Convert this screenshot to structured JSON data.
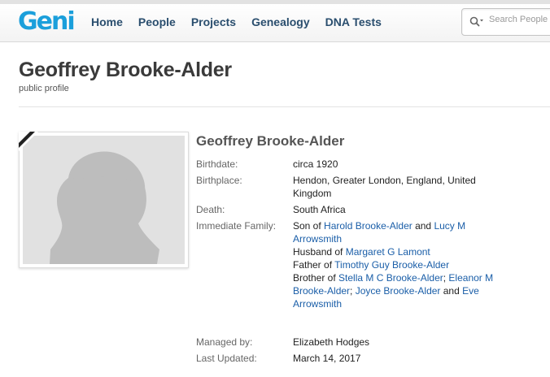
{
  "header": {
    "logo": "Geni",
    "nav": [
      "Home",
      "People",
      "Projects",
      "Genealogy",
      "DNA Tests"
    ],
    "search_placeholder": "Search People"
  },
  "profile": {
    "title": "Geoffrey Brooke-Alder",
    "subtitle": "public profile",
    "name": "Geoffrey Brooke-Alder",
    "birthdate_label": "Birthdate:",
    "birthdate": "circa 1920",
    "birthplace_label": "Birthplace:",
    "birthplace": "Hendon, Greater London, England, United Kingdom",
    "death_label": "Death:",
    "death": "South Africa",
    "family_label": "Immediate Family:",
    "family": {
      "son_of": "Son of ",
      "father_name": "Harold Brooke-Alder",
      "and1": " and ",
      "mother_name": "Lucy M Arrowsmith",
      "husband_of": "Husband of ",
      "wife_name": "Margaret G Lamont",
      "father_of": "Father of ",
      "child_name": "Timothy Guy Brooke-Alder",
      "brother_of": "Brother of ",
      "sibling1": "Stella M C Brooke-Alder",
      "sep1": "; ",
      "sibling2": "Eleanor M Brooke-Alder",
      "sep2": "; ",
      "sibling3": "Joyce Brooke-Alder",
      "and2": " and ",
      "sibling4": "Eve Arrowsmith"
    },
    "managed_label": "Managed by:",
    "managed_by": "Elizabeth Hodges",
    "updated_label": "Last Updated:",
    "updated": "March 14, 2017"
  },
  "colors": {
    "logo": "#1b9fdb",
    "nav": "#2a4e6e",
    "link": "#1a5ea8"
  }
}
